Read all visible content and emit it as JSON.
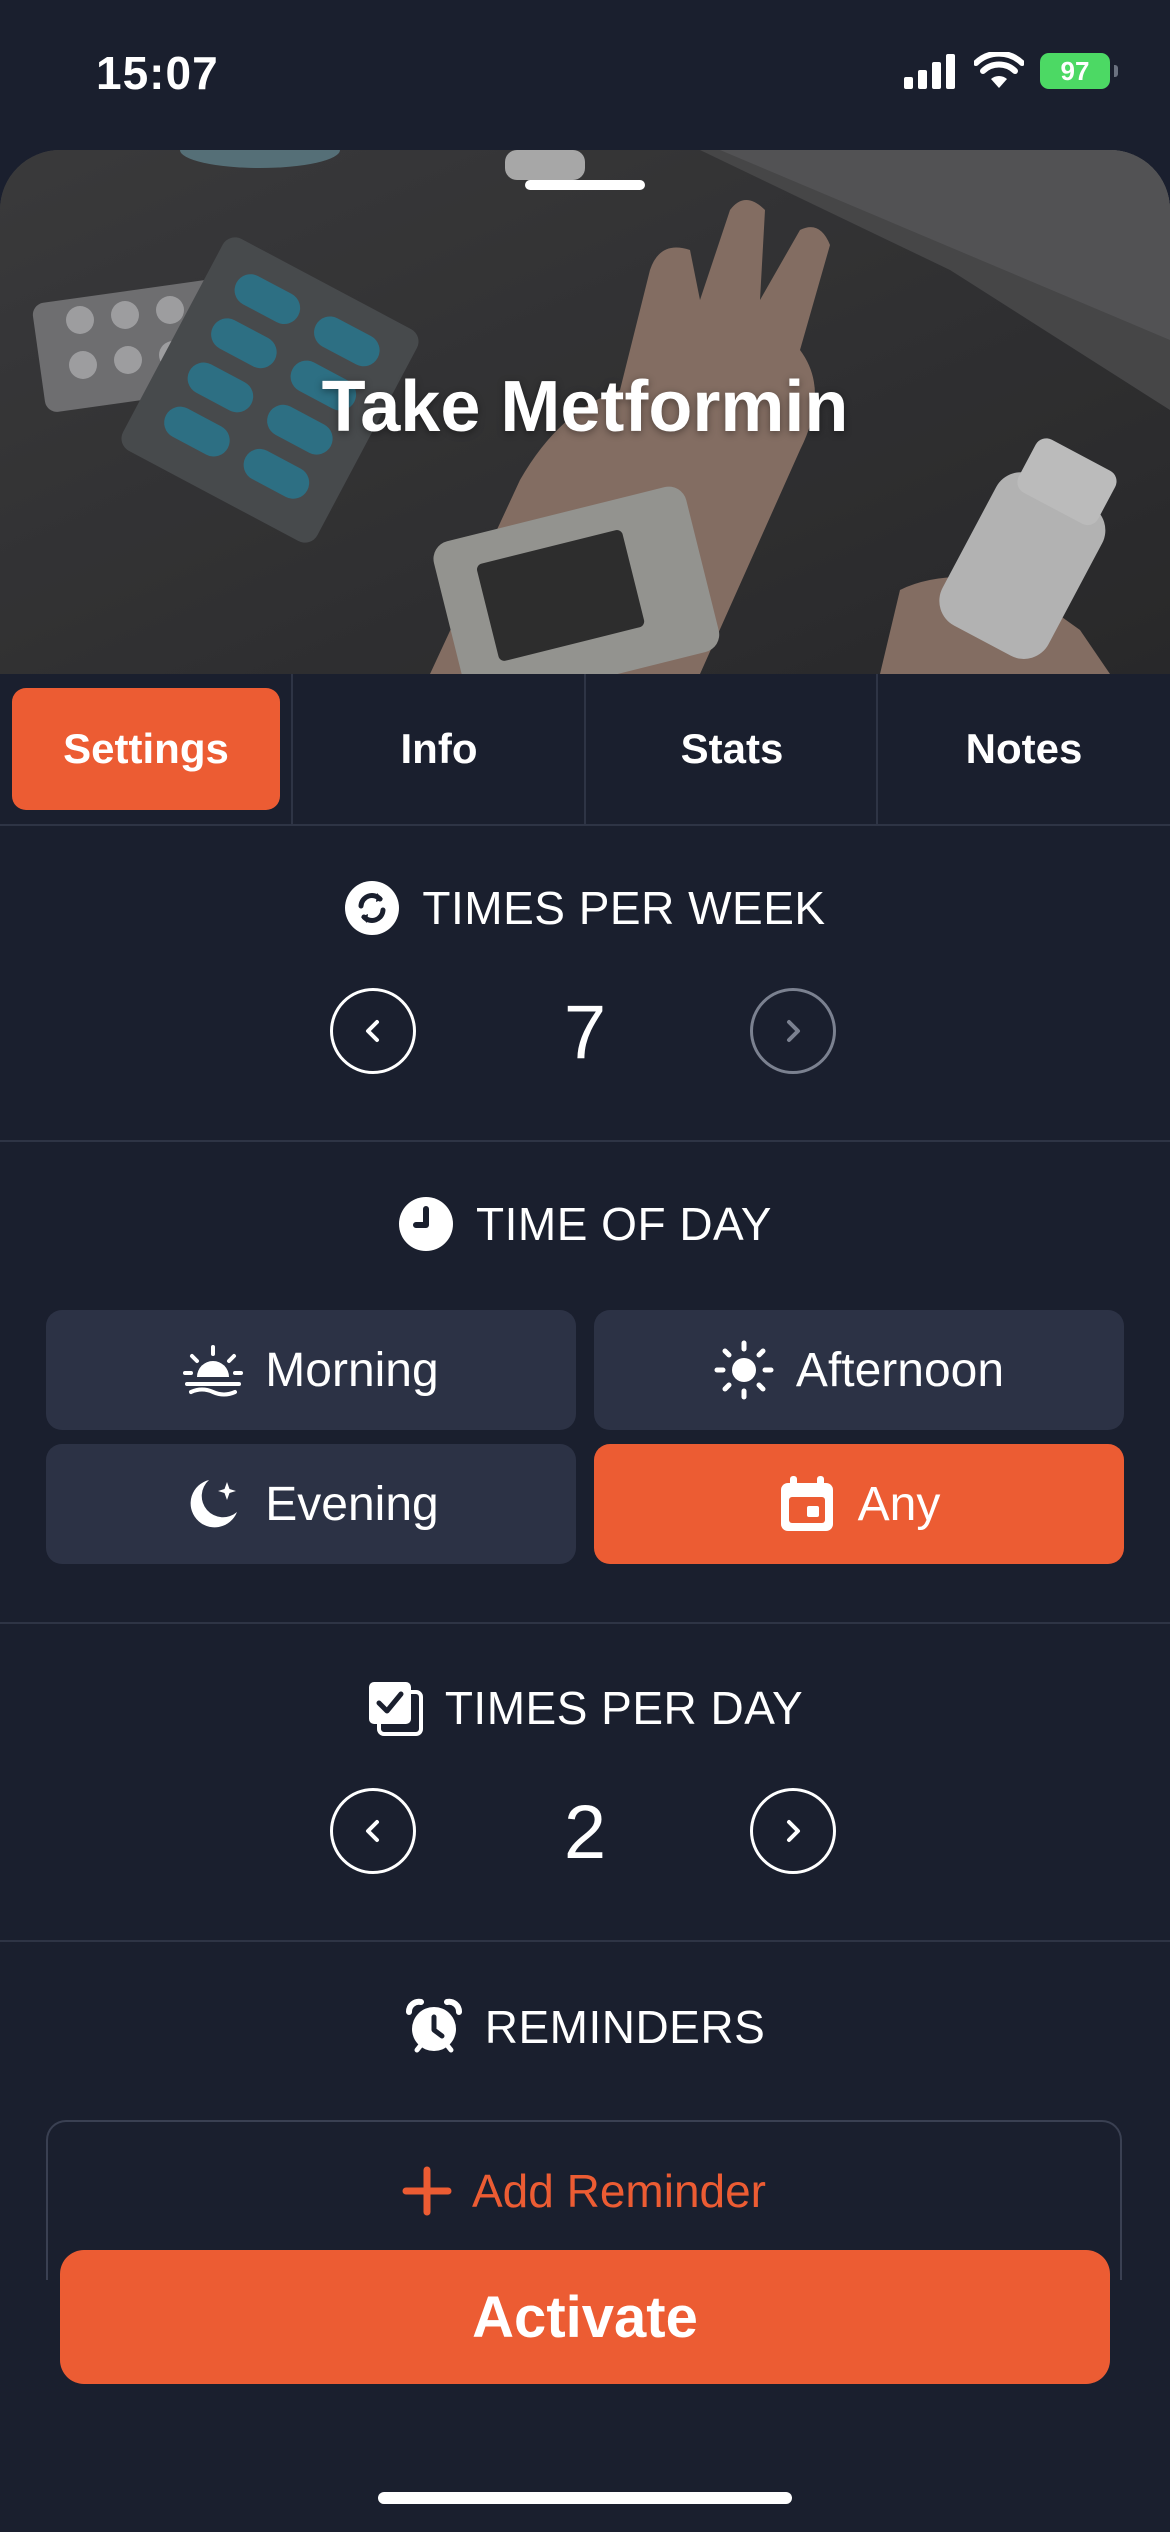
{
  "status": {
    "time": "15:07",
    "battery": "97"
  },
  "hero": {
    "title": "Take Metformin"
  },
  "tabs": [
    {
      "label": "Settings",
      "active": true
    },
    {
      "label": "Info",
      "active": false
    },
    {
      "label": "Stats",
      "active": false
    },
    {
      "label": "Notes",
      "active": false
    }
  ],
  "times_per_week": {
    "heading": "TIMES PER WEEK",
    "value": "7",
    "icon": "repeat-icon"
  },
  "time_of_day": {
    "heading": "TIME OF DAY",
    "icon": "clock-icon",
    "options": [
      {
        "label": "Morning",
        "icon": "sunrise-icon",
        "selected": false
      },
      {
        "label": "Afternoon",
        "icon": "sun-icon",
        "selected": false
      },
      {
        "label": "Evening",
        "icon": "moon-icon",
        "selected": false
      },
      {
        "label": "Any",
        "icon": "calendar-icon",
        "selected": true
      }
    ]
  },
  "times_per_day": {
    "heading": "TIMES PER DAY",
    "value": "2",
    "icon": "checklist-icon"
  },
  "reminders": {
    "heading": "REMINDERS",
    "icon": "alarm-clock-icon",
    "add_label": "Add Reminder"
  },
  "footer": {
    "activate_label": "Activate"
  },
  "colors": {
    "accent": "#ec5c33",
    "background": "#1a1f2e",
    "button_bg": "#2c3245",
    "battery": "#4cd964"
  }
}
